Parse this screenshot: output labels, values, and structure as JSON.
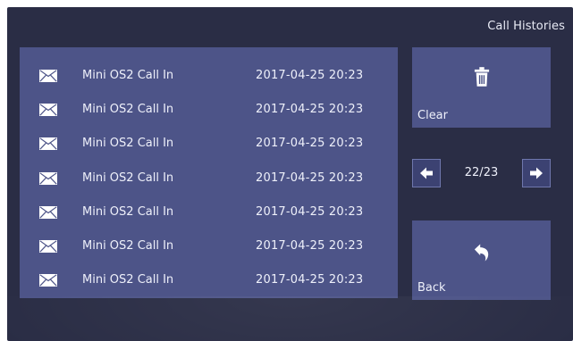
{
  "header": {
    "title": "Call Histories"
  },
  "calls": [
    {
      "name": "Mini OS2 Call In",
      "time": "2017-04-25 20:23",
      "icon": "envelope-icon"
    },
    {
      "name": "Mini OS2 Call In",
      "time": "2017-04-25 20:23",
      "icon": "envelope-icon"
    },
    {
      "name": "Mini OS2 Call In",
      "time": "2017-04-25 20:23",
      "icon": "envelope-icon"
    },
    {
      "name": "Mini OS2 Call In",
      "time": "2017-04-25 20:23",
      "icon": "envelope-icon"
    },
    {
      "name": "Mini OS2 Call In",
      "time": "2017-04-25 20:23",
      "icon": "envelope-icon"
    },
    {
      "name": "Mini OS2 Call In",
      "time": "2017-04-25 20:23",
      "icon": "envelope-icon"
    },
    {
      "name": "Mini OS2 Call In",
      "time": "2017-04-25 20:23",
      "icon": "envelope-icon"
    }
  ],
  "clear": {
    "label": "Clear",
    "icon": "trash-icon"
  },
  "pager": {
    "text": "22/23",
    "prev_icon": "arrow-left-icon",
    "next_icon": "arrow-right-icon"
  },
  "back": {
    "label": "Back",
    "icon": "back-arrow-icon"
  },
  "colors": {
    "screen_bg": "#2a2d45",
    "panel_bg": "#4d5488",
    "text": "#eef0fa"
  }
}
